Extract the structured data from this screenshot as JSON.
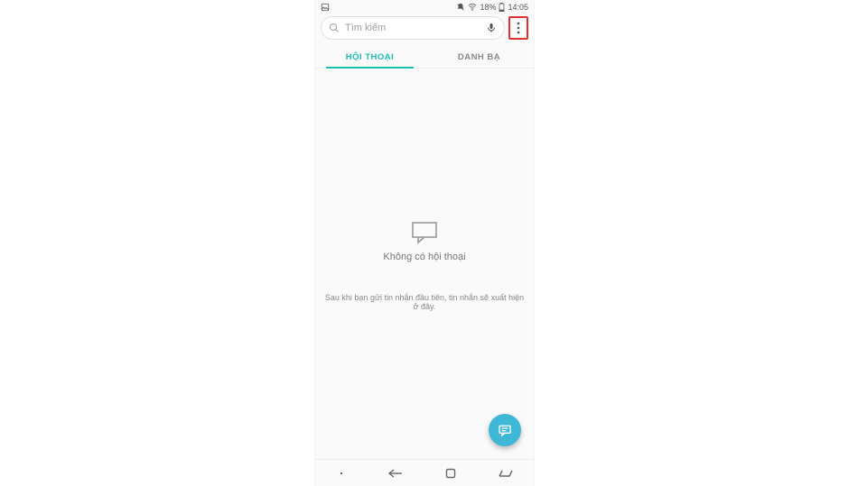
{
  "status": {
    "battery_percent": "18%",
    "time": "14:05"
  },
  "search": {
    "placeholder": "Tìm kiếm"
  },
  "tabs": {
    "items": [
      {
        "label": "HỘI THOẠI"
      },
      {
        "label": "DANH BẠ"
      }
    ]
  },
  "empty": {
    "title": "Không có hội thoại",
    "description": "Sau khi bạn gửi tin nhắn đầu tiên, tin nhắn sẽ xuất hiện ở đây."
  }
}
